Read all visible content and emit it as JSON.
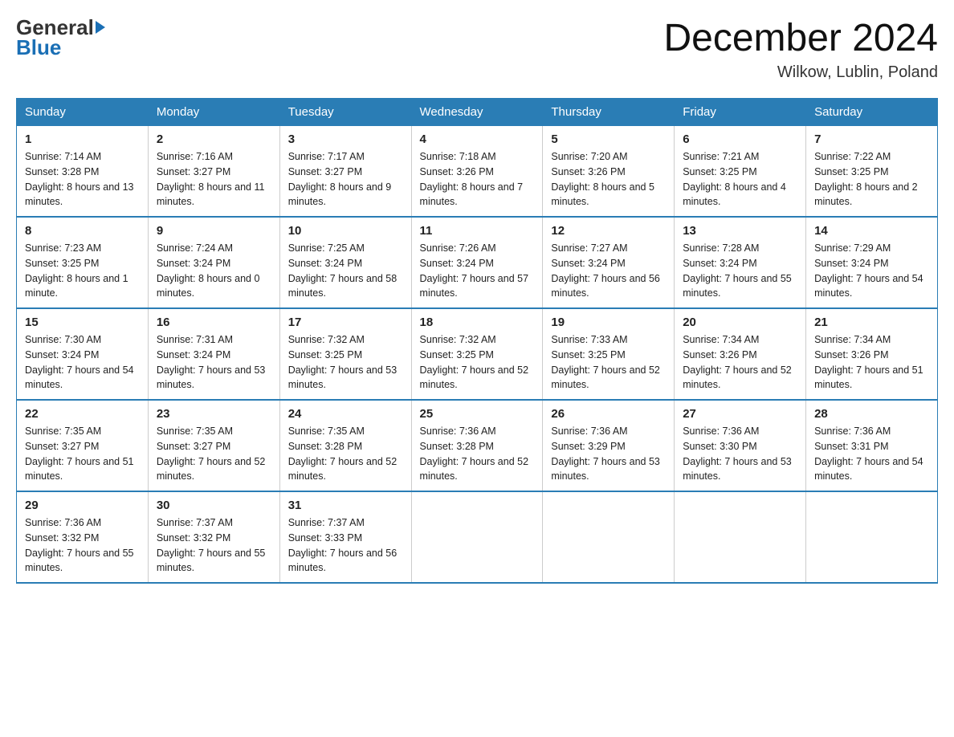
{
  "header": {
    "month_title": "December 2024",
    "location": "Wilkow, Lublin, Poland",
    "logo_general": "General",
    "logo_blue": "Blue"
  },
  "days_of_week": [
    "Sunday",
    "Monday",
    "Tuesday",
    "Wednesday",
    "Thursday",
    "Friday",
    "Saturday"
  ],
  "weeks": [
    [
      {
        "day": "1",
        "sunrise": "7:14 AM",
        "sunset": "3:28 PM",
        "daylight": "8 hours and 13 minutes."
      },
      {
        "day": "2",
        "sunrise": "7:16 AM",
        "sunset": "3:27 PM",
        "daylight": "8 hours and 11 minutes."
      },
      {
        "day": "3",
        "sunrise": "7:17 AM",
        "sunset": "3:27 PM",
        "daylight": "8 hours and 9 minutes."
      },
      {
        "day": "4",
        "sunrise": "7:18 AM",
        "sunset": "3:26 PM",
        "daylight": "8 hours and 7 minutes."
      },
      {
        "day": "5",
        "sunrise": "7:20 AM",
        "sunset": "3:26 PM",
        "daylight": "8 hours and 5 minutes."
      },
      {
        "day": "6",
        "sunrise": "7:21 AM",
        "sunset": "3:25 PM",
        "daylight": "8 hours and 4 minutes."
      },
      {
        "day": "7",
        "sunrise": "7:22 AM",
        "sunset": "3:25 PM",
        "daylight": "8 hours and 2 minutes."
      }
    ],
    [
      {
        "day": "8",
        "sunrise": "7:23 AM",
        "sunset": "3:25 PM",
        "daylight": "8 hours and 1 minute."
      },
      {
        "day": "9",
        "sunrise": "7:24 AM",
        "sunset": "3:24 PM",
        "daylight": "8 hours and 0 minutes."
      },
      {
        "day": "10",
        "sunrise": "7:25 AM",
        "sunset": "3:24 PM",
        "daylight": "7 hours and 58 minutes."
      },
      {
        "day": "11",
        "sunrise": "7:26 AM",
        "sunset": "3:24 PM",
        "daylight": "7 hours and 57 minutes."
      },
      {
        "day": "12",
        "sunrise": "7:27 AM",
        "sunset": "3:24 PM",
        "daylight": "7 hours and 56 minutes."
      },
      {
        "day": "13",
        "sunrise": "7:28 AM",
        "sunset": "3:24 PM",
        "daylight": "7 hours and 55 minutes."
      },
      {
        "day": "14",
        "sunrise": "7:29 AM",
        "sunset": "3:24 PM",
        "daylight": "7 hours and 54 minutes."
      }
    ],
    [
      {
        "day": "15",
        "sunrise": "7:30 AM",
        "sunset": "3:24 PM",
        "daylight": "7 hours and 54 minutes."
      },
      {
        "day": "16",
        "sunrise": "7:31 AM",
        "sunset": "3:24 PM",
        "daylight": "7 hours and 53 minutes."
      },
      {
        "day": "17",
        "sunrise": "7:32 AM",
        "sunset": "3:25 PM",
        "daylight": "7 hours and 53 minutes."
      },
      {
        "day": "18",
        "sunrise": "7:32 AM",
        "sunset": "3:25 PM",
        "daylight": "7 hours and 52 minutes."
      },
      {
        "day": "19",
        "sunrise": "7:33 AM",
        "sunset": "3:25 PM",
        "daylight": "7 hours and 52 minutes."
      },
      {
        "day": "20",
        "sunrise": "7:34 AM",
        "sunset": "3:26 PM",
        "daylight": "7 hours and 52 minutes."
      },
      {
        "day": "21",
        "sunrise": "7:34 AM",
        "sunset": "3:26 PM",
        "daylight": "7 hours and 51 minutes."
      }
    ],
    [
      {
        "day": "22",
        "sunrise": "7:35 AM",
        "sunset": "3:27 PM",
        "daylight": "7 hours and 51 minutes."
      },
      {
        "day": "23",
        "sunrise": "7:35 AM",
        "sunset": "3:27 PM",
        "daylight": "7 hours and 52 minutes."
      },
      {
        "day": "24",
        "sunrise": "7:35 AM",
        "sunset": "3:28 PM",
        "daylight": "7 hours and 52 minutes."
      },
      {
        "day": "25",
        "sunrise": "7:36 AM",
        "sunset": "3:28 PM",
        "daylight": "7 hours and 52 minutes."
      },
      {
        "day": "26",
        "sunrise": "7:36 AM",
        "sunset": "3:29 PM",
        "daylight": "7 hours and 53 minutes."
      },
      {
        "day": "27",
        "sunrise": "7:36 AM",
        "sunset": "3:30 PM",
        "daylight": "7 hours and 53 minutes."
      },
      {
        "day": "28",
        "sunrise": "7:36 AM",
        "sunset": "3:31 PM",
        "daylight": "7 hours and 54 minutes."
      }
    ],
    [
      {
        "day": "29",
        "sunrise": "7:36 AM",
        "sunset": "3:32 PM",
        "daylight": "7 hours and 55 minutes."
      },
      {
        "day": "30",
        "sunrise": "7:37 AM",
        "sunset": "3:32 PM",
        "daylight": "7 hours and 55 minutes."
      },
      {
        "day": "31",
        "sunrise": "7:37 AM",
        "sunset": "3:33 PM",
        "daylight": "7 hours and 56 minutes."
      },
      null,
      null,
      null,
      null
    ]
  ],
  "labels": {
    "sunrise": "Sunrise:",
    "sunset": "Sunset:",
    "daylight": "Daylight:"
  }
}
